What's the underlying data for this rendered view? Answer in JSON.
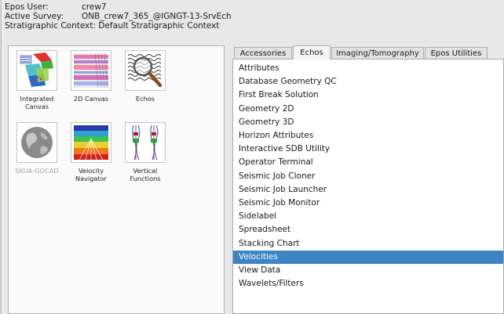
{
  "header": {
    "user_label": "Epos User:",
    "user_value": "crew7",
    "survey_label": "Active Survey:",
    "survey_value": "ONB_crew7_365_@IGNGT-13-SrvEch",
    "context_text": "Stratigraphic Context: Default Stratigraphic Context"
  },
  "tiles": [
    {
      "label": "Integrated\nCanvas",
      "icon": "integrated-canvas-icon",
      "enabled": true
    },
    {
      "label": "2D Canvas",
      "icon": "2d-canvas-icon",
      "enabled": true
    },
    {
      "label": "Echos",
      "icon": "echos-icon",
      "enabled": true
    },
    {
      "label": "SKUA-GOCAD",
      "icon": "skua-gocad-icon",
      "enabled": false
    },
    {
      "label": "Velocity\nNavigator",
      "icon": "velocity-navigator-icon",
      "enabled": true
    },
    {
      "label": "Vertical\nFunctions",
      "icon": "vertical-functions-icon",
      "enabled": true
    }
  ],
  "tabs": [
    {
      "label": "Accessories",
      "active": false
    },
    {
      "label": "Echos",
      "active": true
    },
    {
      "label": "Imaging/Tomography",
      "active": false
    },
    {
      "label": "Epos Utilities",
      "active": false
    }
  ],
  "list_items": [
    "Attributes",
    "Database Geometry QC",
    "First Break Solution",
    "Geometry 2D",
    "Geometry 3D",
    "Horizon Attributes",
    "Interactive SDB Utility",
    "Operator Terminal",
    "Seismic Job Cloner",
    "Seismic Job Launcher",
    "Seismic Job Monitor",
    "Sidelabel",
    "Spreadsheet",
    "Stacking Chart",
    "Velocities",
    "View Data",
    "Wavelets/Filters"
  ],
  "selected_item": "Velocities",
  "colors": {
    "selection": "#3c84c4",
    "panel_bg": "#e8e8e8"
  }
}
